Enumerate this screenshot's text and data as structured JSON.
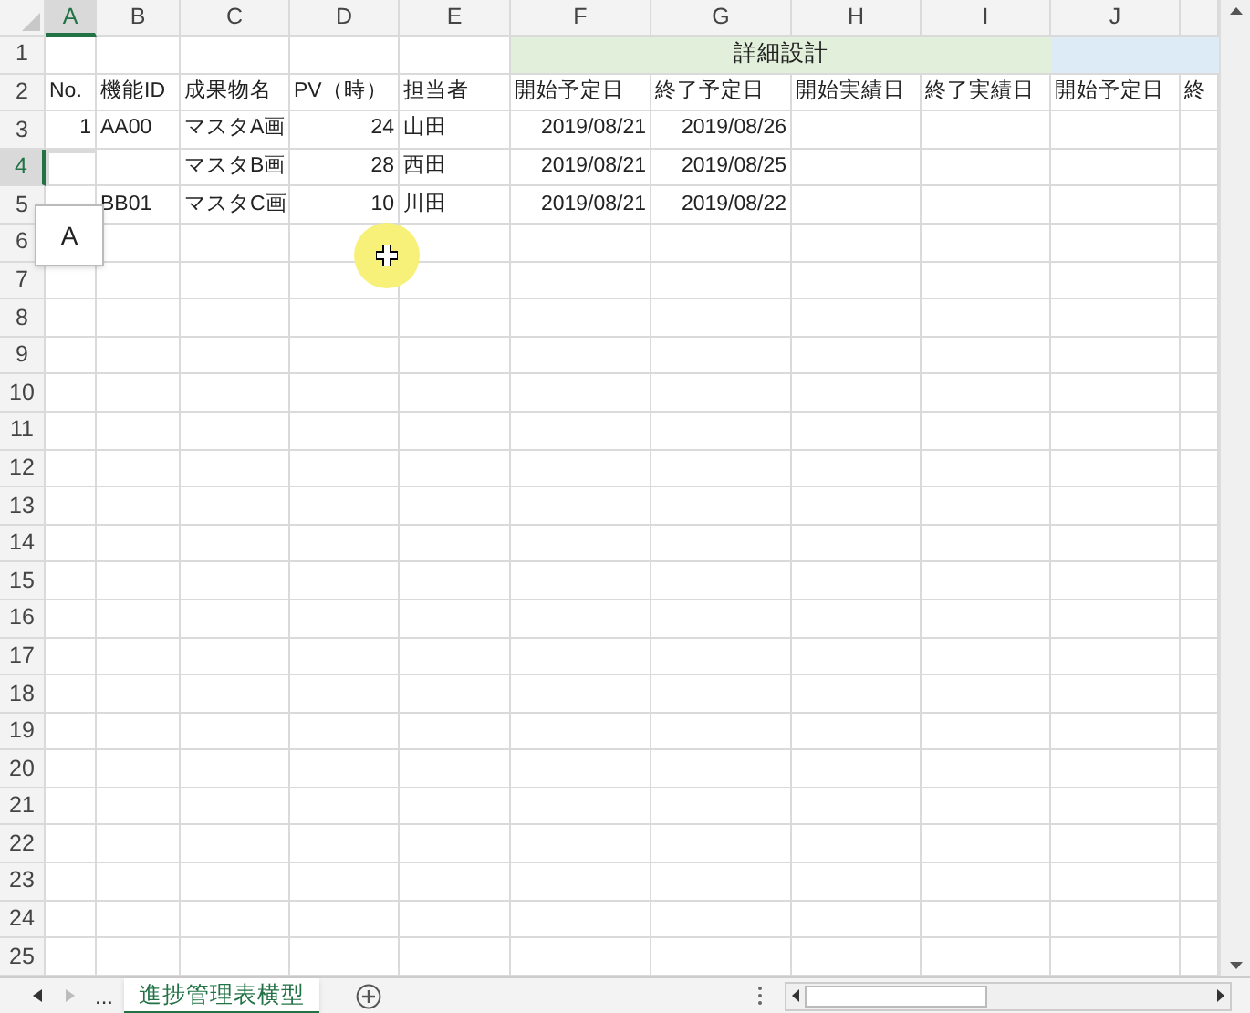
{
  "column_headers": [
    {
      "label": "A",
      "selected": true
    },
    {
      "label": "B",
      "selected": false
    },
    {
      "label": "C",
      "selected": false
    },
    {
      "label": "D",
      "selected": false
    },
    {
      "label": "E",
      "selected": false
    },
    {
      "label": "F",
      "selected": false
    },
    {
      "label": "G",
      "selected": false
    },
    {
      "label": "H",
      "selected": false
    },
    {
      "label": "I",
      "selected": false
    },
    {
      "label": "J",
      "selected": false
    }
  ],
  "group_headers": [
    {
      "label": "詳細設計",
      "color": "#e2efda"
    },
    {
      "color": "#ddebf7"
    }
  ],
  "rows": [
    {
      "number": "2",
      "selected": false,
      "cells": [
        {
          "text": "No.",
          "kind": "text"
        },
        {
          "text": "機能ID",
          "kind": "text"
        },
        {
          "text": "成果物名",
          "kind": "text"
        },
        {
          "text": "PV（時）",
          "kind": "text"
        },
        {
          "text": "担当者",
          "kind": "text"
        },
        {
          "text": "開始予定日",
          "kind": "text"
        },
        {
          "text": "終了予定日",
          "kind": "text"
        },
        {
          "text": "開始実績日",
          "kind": "text"
        },
        {
          "text": "終了実績日",
          "kind": "text"
        },
        {
          "text": "開始予定日",
          "kind": "text"
        },
        {
          "text": "終",
          "kind": "text"
        }
      ]
    },
    {
      "number": "3",
      "selected": false,
      "cells": [
        {
          "text": "1",
          "kind": "number"
        },
        {
          "text": "AA00",
          "kind": "text"
        },
        {
          "text": "マスタA画",
          "kind": "text"
        },
        {
          "text": "24",
          "kind": "number"
        },
        {
          "text": "山田",
          "kind": "text"
        },
        {
          "text": "2019/08/21",
          "kind": "number"
        },
        {
          "text": "2019/08/26",
          "kind": "number"
        },
        null,
        null,
        null,
        null
      ]
    },
    {
      "number": "4",
      "selected": true,
      "cells": [
        null,
        null,
        {
          "text": "マスタB画",
          "kind": "text"
        },
        {
          "text": "28",
          "kind": "number"
        },
        {
          "text": "西田",
          "kind": "text"
        },
        {
          "text": "2019/08/21",
          "kind": "number"
        },
        {
          "text": "2019/08/25",
          "kind": "number"
        },
        null,
        null,
        null,
        null
      ]
    },
    {
      "number": "5",
      "selected": false,
      "cells": [
        null,
        {
          "text": "BB01",
          "kind": "text"
        },
        {
          "text": "マスタC画",
          "kind": "text"
        },
        {
          "text": "10",
          "kind": "number"
        },
        {
          "text": "川田",
          "kind": "text"
        },
        {
          "text": "2019/08/21",
          "kind": "number"
        },
        {
          "text": "2019/08/22",
          "kind": "number"
        },
        null,
        null,
        null,
        null
      ]
    }
  ],
  "empty_row_numbers": [
    "1",
    "6",
    "7",
    "8",
    "9",
    "10",
    "11",
    "12",
    "13",
    "14",
    "15",
    "16",
    "17",
    "18",
    "19",
    "20",
    "21",
    "22",
    "23",
    "24",
    "25"
  ],
  "autocomplete_tip": {
    "text": "A"
  },
  "sheet_tabs": [
    {
      "label": "進捗管理表横型",
      "selected": true
    }
  ],
  "tab_overflow": "..."
}
